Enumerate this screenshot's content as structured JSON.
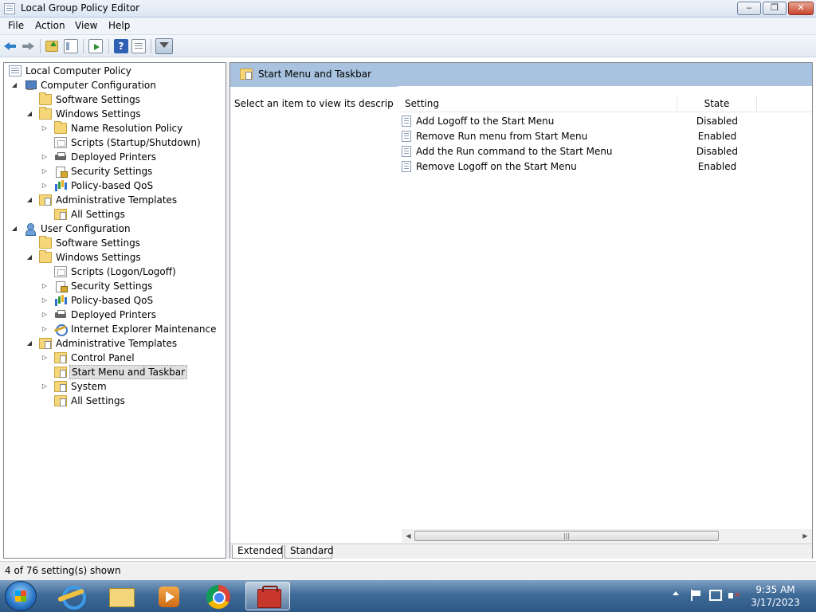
{
  "window": {
    "title": "Local Group Policy Editor",
    "minimize_glyph": "‒",
    "maximize_glyph": "❐",
    "close_glyph": "✕"
  },
  "menu": {
    "items": [
      "File",
      "Action",
      "View",
      "Help"
    ]
  },
  "toolbar": {
    "help_glyph": "?"
  },
  "tree": {
    "root": "Local Computer Policy",
    "computer_configuration": "Computer Configuration",
    "cc_software_settings": "Software Settings",
    "cc_windows_settings": "Windows Settings",
    "cc_name_resolution_policy": "Name Resolution Policy",
    "cc_scripts": "Scripts (Startup/Shutdown)",
    "cc_deployed_printers": "Deployed Printers",
    "cc_security_settings": "Security Settings",
    "cc_policy_qos": "Policy-based QoS",
    "cc_admin_templates": "Administrative Templates",
    "cc_all_settings": "All Settings",
    "user_configuration": "User Configuration",
    "uc_software_settings": "Software Settings",
    "uc_windows_settings": "Windows Settings",
    "uc_scripts": "Scripts (Logon/Logoff)",
    "uc_security_settings": "Security Settings",
    "uc_policy_qos": "Policy-based QoS",
    "uc_deployed_printers": "Deployed Printers",
    "uc_ie_maintenance": "Internet Explorer Maintenance",
    "uc_admin_templates": "Administrative Templates",
    "uc_control_panel": "Control Panel",
    "uc_start_menu_taskbar": "Start Menu and Taskbar",
    "uc_system": "System",
    "uc_all_settings": "All Settings",
    "expanded_glyph": "◢",
    "collapsed_glyph": "▷"
  },
  "right_pane": {
    "header_title": "Start Menu and Taskbar",
    "description_prompt": "Select an item to view its description.",
    "columns": {
      "setting": "Setting",
      "state": "State"
    },
    "rows": [
      {
        "setting": "Add Logoff to the Start Menu",
        "state": "Disabled"
      },
      {
        "setting": "Remove Run menu from Start Menu",
        "state": "Enabled"
      },
      {
        "setting": "Add the Run command to the Start Menu",
        "state": "Disabled"
      },
      {
        "setting": "Remove Logoff on the Start Menu",
        "state": "Enabled"
      }
    ],
    "scroll_left_glyph": "◀",
    "scroll_right_glyph": "▶",
    "scroll_thumb_glyph": "|||",
    "tabs": {
      "extended": "Extended",
      "standard": "Standard"
    }
  },
  "status_bar": {
    "text": "4 of 76 setting(s) shown"
  },
  "taskbar": {
    "time": "9:35 AM",
    "date": "3/17/2023"
  },
  "colors": {
    "header_blue": "#a8c2df",
    "taskbar_blue": "#3f6b99"
  },
  "icons": {
    "tree": [
      "policy-icon",
      "computer-icon",
      "folder-icon",
      "script-icon",
      "printer-icon",
      "security-icon",
      "qos-icon",
      "admin-templates-icon",
      "user-icon",
      "ie-icon"
    ],
    "taskbar": [
      "start-icon",
      "internet-explorer-icon",
      "windows-explorer-icon",
      "media-player-icon",
      "chrome-icon",
      "group-policy-icon"
    ],
    "tray": [
      "show-hidden-icons",
      "action-center-flag-icon",
      "network-icon",
      "volume-muted-icon"
    ]
  }
}
